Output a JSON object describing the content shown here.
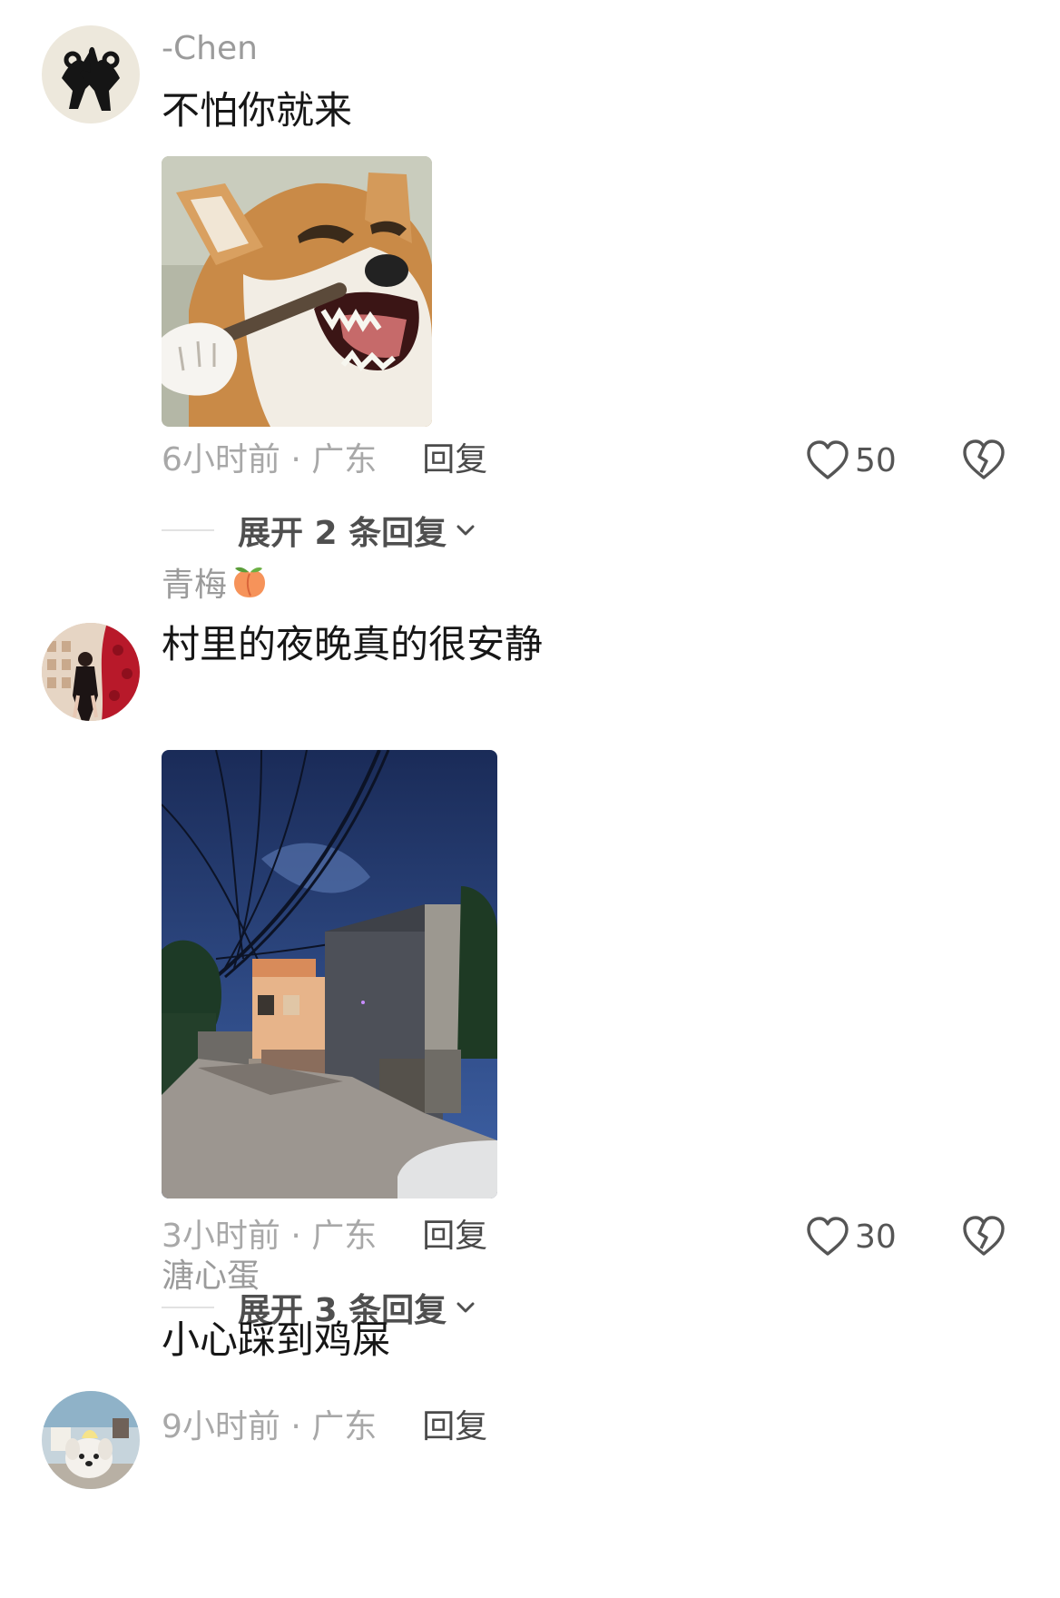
{
  "comments": [
    {
      "username": "-Chen",
      "text": "不怕你就来",
      "time": "6小时前 · 广东",
      "reply_label": "回复",
      "likes": "50",
      "expand_label": "展开 2 条回复"
    },
    {
      "username": "青梅",
      "username_emoji": "peach",
      "text": "村里的夜晚真的很安静",
      "time": "3小时前 · 广东",
      "reply_label": "回复",
      "likes": "30",
      "expand_label": "展开 3 条回复"
    },
    {
      "username": "溏心蛋",
      "text": "小心踩到鸡屎",
      "time": "9小时前 · 广东",
      "reply_label": "回复"
    }
  ],
  "icons": {
    "like": "heart-outline-icon",
    "dislike": "broken-heart-icon",
    "expand": "chevron-down-icon"
  },
  "colors": {
    "username": "#9b9b9b",
    "text": "#161616",
    "meta": "#a8a8a8",
    "reply": "#4a4a4a"
  }
}
